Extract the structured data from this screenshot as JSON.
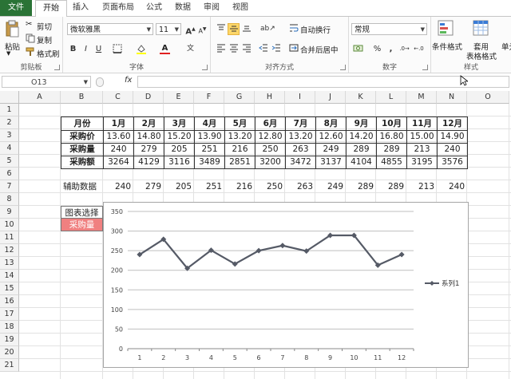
{
  "tabs": {
    "file": "文件",
    "home": "开始",
    "insert": "插入",
    "layout": "页面布局",
    "formula": "公式",
    "data": "数据",
    "review": "审阅",
    "view": "视图"
  },
  "ribbon": {
    "paste": "粘贴",
    "cut": "剪切",
    "copy": "复制",
    "format_painter": "格式刷",
    "clipboard_label": "剪贴板",
    "font_name": "微软雅黑",
    "font_size": "11",
    "font_label": "字体",
    "wrap_text": "自动换行",
    "merge_center": "合并后居中",
    "align_label": "对齐方式",
    "number_format": "常规",
    "number_label": "数字",
    "conditional_format": "条件格式",
    "table_format_1": "套用",
    "table_format_2": "表格格式",
    "cell_styles": "单元",
    "styles_label": "样式"
  },
  "formula_bar": {
    "name_box": "O13",
    "fx": "fx",
    "formula": ""
  },
  "sheet": {
    "columns": [
      "A",
      "B",
      "C",
      "D",
      "E",
      "F",
      "G",
      "H",
      "I",
      "J",
      "K",
      "L",
      "M",
      "N",
      "O"
    ],
    "rows": [
      "1",
      "2",
      "3",
      "4",
      "5",
      "6",
      "7",
      "8",
      "9",
      "10",
      "11",
      "12",
      "13",
      "14",
      "15",
      "16",
      "17",
      "18",
      "19",
      "20",
      "21"
    ],
    "table_header_label": "月份",
    "months": [
      "1月",
      "2月",
      "3月",
      "4月",
      "5月",
      "6月",
      "7月",
      "8月",
      "9月",
      "10月",
      "11月",
      "12月"
    ],
    "row_labels": [
      "采购价",
      "采购量",
      "采购额"
    ],
    "price": [
      "13.60",
      "14.80",
      "15.20",
      "13.90",
      "13.20",
      "12.80",
      "13.20",
      "12.60",
      "14.20",
      "16.80",
      "15.00",
      "14.90"
    ],
    "qty": [
      "240",
      "279",
      "205",
      "251",
      "216",
      "250",
      "263",
      "249",
      "289",
      "289",
      "213",
      "240"
    ],
    "amount": [
      "3264",
      "4129",
      "3116",
      "3489",
      "2851",
      "3200",
      "3472",
      "3137",
      "4104",
      "4855",
      "3195",
      "3576"
    ],
    "aux_label": "辅助数据",
    "aux": [
      "240",
      "279",
      "205",
      "251",
      "216",
      "250",
      "263",
      "249",
      "289",
      "289",
      "213",
      "240"
    ],
    "chart_select_label": "图表选择",
    "chart_select_value": "采购量",
    "chart_select_color": "#f08080"
  },
  "chart_data": {
    "type": "line",
    "categories": [
      "1",
      "2",
      "3",
      "4",
      "5",
      "6",
      "7",
      "8",
      "9",
      "10",
      "11",
      "12"
    ],
    "series": [
      {
        "name": "系列1",
        "values": [
          240,
          279,
          205,
          251,
          216,
          250,
          263,
          249,
          289,
          289,
          213,
          240
        ],
        "color": "#555a66"
      }
    ],
    "ylim": [
      0,
      350
    ],
    "yticks": [
      "0",
      "50",
      "100",
      "150",
      "200",
      "250",
      "300",
      "350"
    ],
    "grid": true,
    "legend": "right",
    "title": "",
    "xlabel": "",
    "ylabel": ""
  }
}
